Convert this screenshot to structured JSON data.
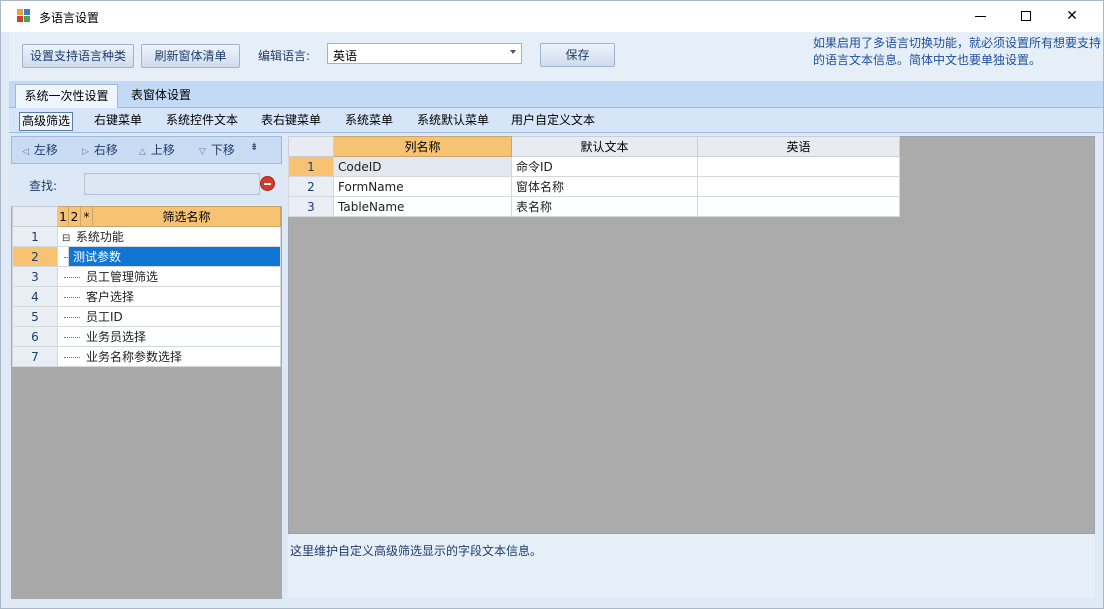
{
  "window": {
    "title": "多语言设置"
  },
  "toolbar": {
    "set_languages_label": "设置支持语言种类",
    "refresh_forms_label": "刷新窗体清单",
    "edit_language_label": "编辑语言:",
    "edit_language_value": "英语",
    "save_label": "保存",
    "notice": "如果启用了多语言切换功能，就必须设置所有想要支持的语言文本信息。简体中文也要单独设置。"
  },
  "tabs": [
    "系统一次性设置",
    "表窗体设置"
  ],
  "subtabs": [
    "高级筛选",
    "右键菜单",
    "系统控件文本",
    "表右键菜单",
    "系统菜单",
    "系统默认菜单",
    "用户自定义文本"
  ],
  "move": {
    "left": "左移",
    "right": "右移",
    "up": "上移",
    "down": "下移"
  },
  "find": {
    "label": "查找:",
    "value": ""
  },
  "filter_grid": {
    "headers": [
      "1",
      "2",
      "*",
      "筛选名称"
    ],
    "rows": [
      {
        "num": "1",
        "name": "系统功能"
      },
      {
        "num": "2",
        "name": "测试参数"
      },
      {
        "num": "3",
        "name": "员工管理筛选"
      },
      {
        "num": "4",
        "name": "客户选择"
      },
      {
        "num": "5",
        "name": "员工ID"
      },
      {
        "num": "6",
        "name": "业务员选择"
      },
      {
        "num": "7",
        "name": "业务名称参数选择"
      }
    ]
  },
  "field_grid": {
    "headers": [
      "列名称",
      "默认文本",
      "英语"
    ],
    "rows": [
      {
        "num": "1",
        "col": "CodeID",
        "default": "命令ID",
        "en": ""
      },
      {
        "num": "2",
        "col": "FormName",
        "default": "窗体名称",
        "en": ""
      },
      {
        "num": "3",
        "col": "TableName",
        "default": "表名称",
        "en": ""
      }
    ]
  },
  "description": "这里维护自定义高级筛选显示的字段文本信息。"
}
